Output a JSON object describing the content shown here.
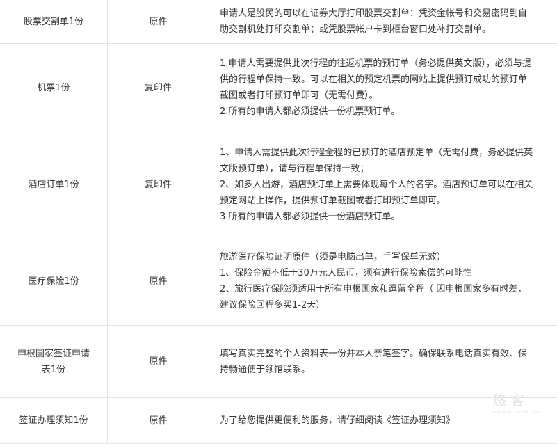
{
  "rows": [
    {
      "item": "股票交割单1份",
      "type": "原件",
      "desc": [
        "申请人是股民的可以在证券大厅打印股票交割单：凭资金帐号和交易密码到自",
        "助交割机处打印交割单；或凭股票帐户卡到柜台窗口处补打交割单。"
      ]
    },
    {
      "item": "机票1份",
      "type": "复印件",
      "desc": [
        "1.申请人需要提供此次行程的往返机票的预订单（务必提供英文版），必须与提",
        "供的行程单保持一致。可以在相关的预定机票的网站上提供预订成功的预订单",
        "截图或者打印预订单即可（无需付费）。",
        "2.所有的申请人都必须提供一份机票预订单。"
      ]
    },
    {
      "item": "酒店订单1份",
      "type": "复印件",
      "desc": [
        "1、申请人需提供此次行程全程的已预订的酒店预定单（无需付费，务必提供英",
        "文版预订单），请与行程单保持一致；",
        "2、如多人出游，酒店预订单上需要体现每个人的名字。酒店预订单可以在相关",
        "预定网站上操作，提供预订单截图或者打印预订单即可。",
        "3.所有的申请人都必须提供一份酒店预订单。"
      ]
    },
    {
      "item": "医疗保险1份",
      "type": "原件",
      "desc": [
        "旅游医疗保险证明原件（须是电脑出单，手写保单无效）",
        "1、保险金额不低于30万元人民币，须有进行保险索偿的可能性",
        "2、旅行医疗保险须适用于所有申根国家和逗留全程（ 因申根国家多有时差，",
        "建议保险回程多买1-2天）"
      ]
    },
    {
      "item": [
        "申根国家签证申请",
        "表1份"
      ],
      "type": "原件",
      "desc": [
        "填写真实完整的个人资料表一份并本人亲笔签字。确保联系电话真实有效、保",
        "持畅通便于领馆联系。"
      ]
    },
    {
      "item": "签证办理须知1份",
      "type": "原件",
      "desc": [
        "为了给您提供更便利的服务，请仔细阅读《签证办理须知》"
      ]
    }
  ],
  "watermark": {
    "text": "悠客",
    "sub": "www.ie-web.com"
  }
}
